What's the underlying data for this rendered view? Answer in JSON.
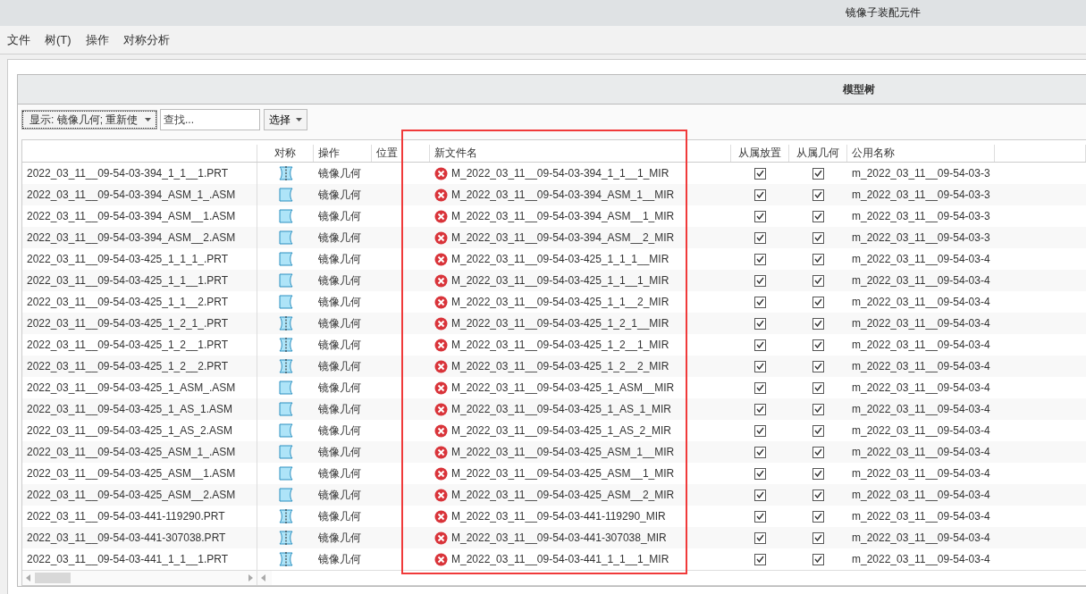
{
  "window": {
    "title": "镜像子装配元件"
  },
  "menu": [
    "文件",
    "树(T)",
    "操作",
    "对称分析"
  ],
  "panel": {
    "title": "模型树"
  },
  "toolbar": {
    "display_dropdown": "显示: 镜像几何; 重新使",
    "search": {
      "placeholder": "查找..."
    },
    "select_button": "选择"
  },
  "table": {
    "columns": [
      "对称",
      "操作",
      "位置",
      "新文件名",
      "从属放置",
      "从属几何",
      "公用名称"
    ],
    "rows": [
      {
        "name": "2022_03_11__09-54-03-394_1_1__1.PRT",
        "kind": "symmetric",
        "operation": "镜像几何",
        "new_name": "M_2022_03_11__09-54-03-394_1_1__1_MIR",
        "placement": true,
        "geometry": true,
        "common_name": "m_2022_03_11__09-54-03-3"
      },
      {
        "name": "2022_03_11__09-54-03-394_ASM_1_.ASM",
        "kind": "mirror",
        "operation": "镜像几何",
        "new_name": "M_2022_03_11__09-54-03-394_ASM_1__MIR",
        "placement": true,
        "geometry": true,
        "common_name": "m_2022_03_11__09-54-03-3"
      },
      {
        "name": "2022_03_11__09-54-03-394_ASM__1.ASM",
        "kind": "mirror",
        "operation": "镜像几何",
        "new_name": "M_2022_03_11__09-54-03-394_ASM__1_MIR",
        "placement": true,
        "geometry": true,
        "common_name": "m_2022_03_11__09-54-03-3"
      },
      {
        "name": "2022_03_11__09-54-03-394_ASM__2.ASM",
        "kind": "mirror",
        "operation": "镜像几何",
        "new_name": "M_2022_03_11__09-54-03-394_ASM__2_MIR",
        "placement": true,
        "geometry": true,
        "common_name": "m_2022_03_11__09-54-03-3"
      },
      {
        "name": "2022_03_11__09-54-03-425_1_1_1_.PRT",
        "kind": "mirror",
        "operation": "镜像几何",
        "new_name": "M_2022_03_11__09-54-03-425_1_1_1__MIR",
        "placement": true,
        "geometry": true,
        "common_name": "m_2022_03_11__09-54-03-4"
      },
      {
        "name": "2022_03_11__09-54-03-425_1_1__1.PRT",
        "kind": "mirror",
        "operation": "镜像几何",
        "new_name": "M_2022_03_11__09-54-03-425_1_1__1_MIR",
        "placement": true,
        "geometry": true,
        "common_name": "m_2022_03_11__09-54-03-4"
      },
      {
        "name": "2022_03_11__09-54-03-425_1_1__2.PRT",
        "kind": "mirror",
        "operation": "镜像几何",
        "new_name": "M_2022_03_11__09-54-03-425_1_1__2_MIR",
        "placement": true,
        "geometry": true,
        "common_name": "m_2022_03_11__09-54-03-4"
      },
      {
        "name": "2022_03_11__09-54-03-425_1_2_1_.PRT",
        "kind": "symmetric",
        "operation": "镜像几何",
        "new_name": "M_2022_03_11__09-54-03-425_1_2_1__MIR",
        "placement": true,
        "geometry": true,
        "common_name": "m_2022_03_11__09-54-03-4"
      },
      {
        "name": "2022_03_11__09-54-03-425_1_2__1.PRT",
        "kind": "symmetric",
        "operation": "镜像几何",
        "new_name": "M_2022_03_11__09-54-03-425_1_2__1_MIR",
        "placement": true,
        "geometry": true,
        "common_name": "m_2022_03_11__09-54-03-4"
      },
      {
        "name": "2022_03_11__09-54-03-425_1_2__2.PRT",
        "kind": "symmetric",
        "operation": "镜像几何",
        "new_name": "M_2022_03_11__09-54-03-425_1_2__2_MIR",
        "placement": true,
        "geometry": true,
        "common_name": "m_2022_03_11__09-54-03-4"
      },
      {
        "name": "2022_03_11__09-54-03-425_1_ASM_.ASM",
        "kind": "mirror",
        "operation": "镜像几何",
        "new_name": "M_2022_03_11__09-54-03-425_1_ASM__MIR",
        "placement": true,
        "geometry": true,
        "common_name": "m_2022_03_11__09-54-03-4"
      },
      {
        "name": "2022_03_11__09-54-03-425_1_AS_1.ASM",
        "kind": "mirror",
        "operation": "镜像几何",
        "new_name": "M_2022_03_11__09-54-03-425_1_AS_1_MIR",
        "placement": true,
        "geometry": true,
        "common_name": "m_2022_03_11__09-54-03-4"
      },
      {
        "name": "2022_03_11__09-54-03-425_1_AS_2.ASM",
        "kind": "mirror",
        "operation": "镜像几何",
        "new_name": "M_2022_03_11__09-54-03-425_1_AS_2_MIR",
        "placement": true,
        "geometry": true,
        "common_name": "m_2022_03_11__09-54-03-4"
      },
      {
        "name": "2022_03_11__09-54-03-425_ASM_1_.ASM",
        "kind": "mirror",
        "operation": "镜像几何",
        "new_name": "M_2022_03_11__09-54-03-425_ASM_1__MIR",
        "placement": true,
        "geometry": true,
        "common_name": "m_2022_03_11__09-54-03-4"
      },
      {
        "name": "2022_03_11__09-54-03-425_ASM__1.ASM",
        "kind": "mirror",
        "operation": "镜像几何",
        "new_name": "M_2022_03_11__09-54-03-425_ASM__1_MIR",
        "placement": true,
        "geometry": true,
        "common_name": "m_2022_03_11__09-54-03-4"
      },
      {
        "name": "2022_03_11__09-54-03-425_ASM__2.ASM",
        "kind": "mirror",
        "operation": "镜像几何",
        "new_name": "M_2022_03_11__09-54-03-425_ASM__2_MIR",
        "placement": true,
        "geometry": true,
        "common_name": "m_2022_03_11__09-54-03-4"
      },
      {
        "name": "2022_03_11__09-54-03-441-119290.PRT",
        "kind": "symmetric",
        "operation": "镜像几何",
        "new_name": "M_2022_03_11__09-54-03-441-119290_MIR",
        "placement": true,
        "geometry": true,
        "common_name": "m_2022_03_11__09-54-03-4"
      },
      {
        "name": "2022_03_11__09-54-03-441-307038.PRT",
        "kind": "symmetric",
        "operation": "镜像几何",
        "new_name": "M_2022_03_11__09-54-03-441-307038_MIR",
        "placement": true,
        "geometry": true,
        "common_name": "m_2022_03_11__09-54-03-4"
      },
      {
        "name": "2022_03_11__09-54-03-441_1_1__1.PRT",
        "kind": "symmetric",
        "operation": "镜像几何",
        "new_name": "M_2022_03_11__09-54-03-441_1_1__1_MIR",
        "placement": true,
        "geometry": true,
        "common_name": "m_2022_03_11__09-54-03-4"
      }
    ]
  }
}
